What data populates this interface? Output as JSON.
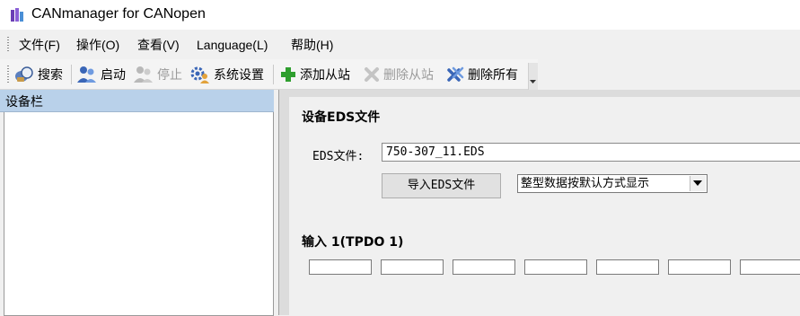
{
  "window": {
    "title": "CANmanager for CANopen"
  },
  "menu": [
    {
      "label": "文件(F)"
    },
    {
      "label": "操作(O)"
    },
    {
      "label": "查看(V)"
    },
    {
      "label": "Language(L)"
    },
    {
      "label": "帮助(H)"
    }
  ],
  "toolbar": {
    "search": "搜索",
    "start": "启动",
    "stop": "停止",
    "settings": "系统设置",
    "add_slave": "添加从站",
    "remove_slave": "删除从站",
    "remove_all": "删除所有"
  },
  "device_panel": {
    "title": "设备栏"
  },
  "eds": {
    "section_title": "设备EDS文件",
    "file_label": "EDS文件:",
    "file_value": "750-307_11.EDS",
    "import_label": "导入EDS文件",
    "display_mode": "整型数据按默认方式显示"
  },
  "input": {
    "section_title": "输入 1(TPDO 1)"
  },
  "colors": {
    "panel_header": "#b9d1ea",
    "add_icon": "#2e9e2e"
  }
}
